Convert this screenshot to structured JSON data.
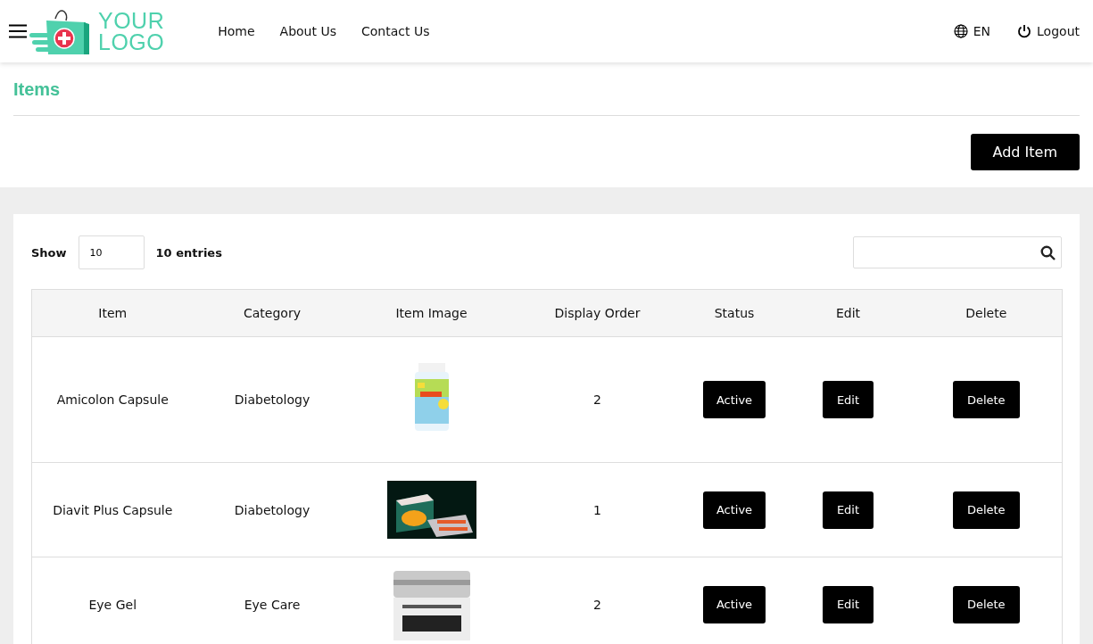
{
  "header": {
    "logo": {
      "line_1": "YOUR",
      "line_2": "LOGO"
    },
    "nav": [
      {
        "label": "Home"
      },
      {
        "label": "About Us"
      },
      {
        "label": "Contact Us"
      }
    ],
    "language": "EN",
    "logout": "Logout"
  },
  "page": {
    "title": "Items",
    "add_button": "Add Item"
  },
  "table_controls": {
    "show_label": "Show",
    "page_size": "10",
    "entries_label": "10 entries"
  },
  "table": {
    "columns": [
      "Item",
      "Category",
      "Item Image",
      "Display Order",
      "Status",
      "Edit",
      "Delete"
    ],
    "rows": [
      {
        "item": "Amicolon Capsule",
        "category": "Diabetology",
        "order": "2",
        "status": "Active",
        "edit": "Edit",
        "delete": "Delete"
      },
      {
        "item": "Diavit Plus Capsule",
        "category": "Diabetology",
        "order": "1",
        "status": "Active",
        "edit": "Edit",
        "delete": "Delete"
      },
      {
        "item": "Eye Gel",
        "category": "Eye Care",
        "order": "2",
        "status": "Active",
        "edit": "Edit",
        "delete": "Delete"
      }
    ]
  }
}
